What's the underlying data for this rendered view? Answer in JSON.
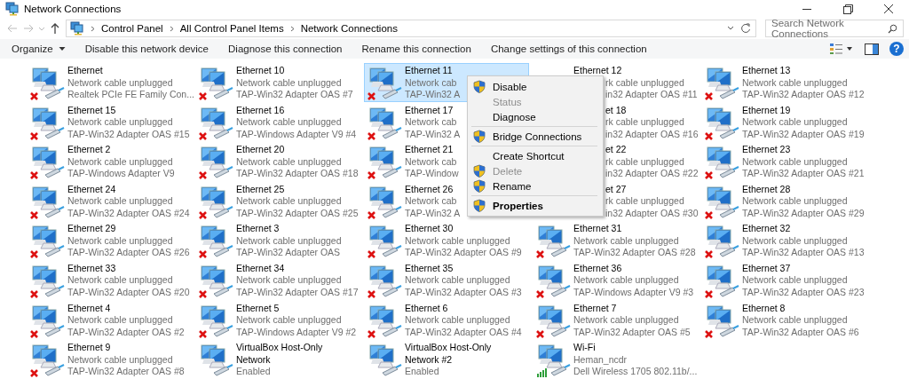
{
  "window": {
    "title": "Network Connections"
  },
  "address": {
    "crumbs": [
      "Control Panel",
      "All Control Panel Items",
      "Network Connections"
    ],
    "search_placeholder": "Search Network Connections"
  },
  "toolbar": {
    "buttons": [
      {
        "label": "Organize",
        "dropdown": true
      },
      {
        "label": "Disable this network device",
        "dropdown": false
      },
      {
        "label": "Diagnose this connection",
        "dropdown": false
      },
      {
        "label": "Rename this connection",
        "dropdown": false
      },
      {
        "label": "Change settings of this connection",
        "dropdown": false
      }
    ],
    "help": "?"
  },
  "items": [
    {
      "name": "Ethernet",
      "status": "Network cable unplugged",
      "device": "Realtek PCIe FE Family Con...",
      "kind": "unplugged",
      "selected": false
    },
    {
      "name": "Ethernet 10",
      "status": "Network cable unplugged",
      "device": "TAP-Win32 Adapter OAS #7",
      "kind": "unplugged",
      "selected": false
    },
    {
      "name": "Ethernet 11",
      "status": "Network cab",
      "device": "TAP-Win32 A",
      "kind": "unplugged",
      "selected": true
    },
    {
      "name": "Ethernet 12",
      "status": "rk cable unplugged",
      "device": "in32 Adapter OAS #11",
      "selected": false,
      "lines_clipped": true,
      "name_clipped": false
    },
    {
      "name": "Ethernet 13",
      "status": "Network cable unplugged",
      "device": "TAP-Win32 Adapter OAS #12",
      "kind": "unplugged",
      "selected": false
    },
    {
      "name": "Ethernet 15",
      "status": "Network cable unplugged",
      "device": "TAP-Win32 Adapter OAS #15",
      "kind": "unplugged",
      "selected": false
    },
    {
      "name": "Ethernet 16",
      "status": "Network cable unplugged",
      "device": "TAP-Windows Adapter V9 #4",
      "kind": "unplugged",
      "selected": false
    },
    {
      "name": "Ethernet 17",
      "status": "Network cab",
      "device": "TAP-Win32 A",
      "kind": "unplugged",
      "selected": false
    },
    {
      "name": "et 18",
      "status": "rk cable unplugged",
      "device": "in32 Adapter OAS #16",
      "selected": false,
      "lines_clipped": true,
      "name_clipped": true
    },
    {
      "name": "Ethernet 19",
      "status": "Network cable unplugged",
      "device": "TAP-Win32 Adapter OAS #19",
      "kind": "unplugged",
      "selected": false
    },
    {
      "name": "Ethernet 2",
      "status": "Network cable unplugged",
      "device": "TAP-Windows Adapter V9",
      "kind": "unplugged",
      "selected": false
    },
    {
      "name": "Ethernet 20",
      "status": "Network cable unplugged",
      "device": "TAP-Win32 Adapter OAS #18",
      "kind": "unplugged",
      "selected": false
    },
    {
      "name": "Ethernet 21",
      "status": "Network cab",
      "device": "TAP-Window",
      "kind": "unplugged",
      "selected": false
    },
    {
      "name": "et 22",
      "status": "rk cable unplugged",
      "device": "in32 Adapter OAS #22",
      "selected": false,
      "lines_clipped": true,
      "name_clipped": true
    },
    {
      "name": "Ethernet 23",
      "status": "Network cable unplugged",
      "device": "TAP-Win32 Adapter OAS #21",
      "kind": "unplugged",
      "selected": false
    },
    {
      "name": "Ethernet 24",
      "status": "Network cable unplugged",
      "device": "TAP-Win32 Adapter OAS #24",
      "kind": "unplugged",
      "selected": false
    },
    {
      "name": "Ethernet 25",
      "status": "Network cable unplugged",
      "device": "TAP-Win32 Adapter OAS #25",
      "kind": "unplugged",
      "selected": false
    },
    {
      "name": "Ethernet 26",
      "status": "Network cab",
      "device": "TAP-Win32 A",
      "kind": "unplugged",
      "selected": false
    },
    {
      "name": "et 27",
      "status": "rk cable unplugged",
      "device": "in32 Adapter OAS #30",
      "selected": false,
      "lines_clipped": true,
      "name_clipped": true
    },
    {
      "name": "Ethernet 28",
      "status": "Network cable unplugged",
      "device": "TAP-Win32 Adapter OAS #29",
      "kind": "unplugged",
      "selected": false
    },
    {
      "name": "Ethernet 29",
      "status": "Network cable unplugged",
      "device": "TAP-Win32 Adapter OAS #26",
      "kind": "unplugged",
      "selected": false
    },
    {
      "name": "Ethernet 3",
      "status": "Network cable unplugged",
      "device": "TAP-Win32 Adapter OAS",
      "kind": "unplugged",
      "selected": false
    },
    {
      "name": "Ethernet 30",
      "status": "Network cable unplugged",
      "device": "TAP-Win32 Adapter OAS #9",
      "kind": "unplugged",
      "selected": false
    },
    {
      "name": "Ethernet 31",
      "status": "Network cable unplugged",
      "device": "TAP-Win32 Adapter OAS #28",
      "kind": "unplugged",
      "selected": false
    },
    {
      "name": "Ethernet 32",
      "status": "Network cable unplugged",
      "device": "TAP-Win32 Adapter OAS #13",
      "kind": "unplugged",
      "selected": false
    },
    {
      "name": "Ethernet 33",
      "status": "Network cable unplugged",
      "device": "TAP-Win32 Adapter OAS #20",
      "kind": "unplugged",
      "selected": false
    },
    {
      "name": "Ethernet 34",
      "status": "Network cable unplugged",
      "device": "TAP-Win32 Adapter OAS #17",
      "kind": "unplugged",
      "selected": false
    },
    {
      "name": "Ethernet 35",
      "status": "Network cable unplugged",
      "device": "TAP-Win32 Adapter OAS #3",
      "kind": "unplugged",
      "selected": false
    },
    {
      "name": "Ethernet 36",
      "status": "Network cable unplugged",
      "device": "TAP-Windows Adapter V9 #3",
      "kind": "unplugged",
      "selected": false
    },
    {
      "name": "Ethernet 37",
      "status": "Network cable unplugged",
      "device": "TAP-Win32 Adapter OAS #23",
      "kind": "unplugged",
      "selected": false
    },
    {
      "name": "Ethernet 4",
      "status": "Network cable unplugged",
      "device": "TAP-Win32 Adapter OAS #2",
      "kind": "unplugged",
      "selected": false
    },
    {
      "name": "Ethernet 5",
      "status": "Network cable unplugged",
      "device": "TAP-Windows Adapter V9 #2",
      "kind": "unplugged",
      "selected": false
    },
    {
      "name": "Ethernet 6",
      "status": "Network cable unplugged",
      "device": "TAP-Win32 Adapter OAS #4",
      "kind": "unplugged",
      "selected": false
    },
    {
      "name": "Ethernet 7",
      "status": "Network cable unplugged",
      "device": "TAP-Win32 Adapter OAS #5",
      "kind": "unplugged",
      "selected": false
    },
    {
      "name": "Ethernet 8",
      "status": "Network cable unplugged",
      "device": "TAP-Win32 Adapter OAS #6",
      "kind": "unplugged",
      "selected": false
    },
    {
      "name": "Ethernet 9",
      "status": "Network cable unplugged",
      "device": "TAP-Win32 Adapter OAS #8",
      "kind": "unplugged",
      "selected": false
    },
    {
      "name": "VirtualBox Host-Only Network",
      "status": "Enabled",
      "kind": "wired",
      "selected": false
    },
    {
      "name": "VirtualBox Host-Only Network #2",
      "status": "Enabled",
      "kind": "wired",
      "selected": false
    },
    {
      "name": "Wi-Fi",
      "status": "Heman_ncdr",
      "device": "Dell Wireless 1705 802.11b/...",
      "kind": "wifi",
      "selected": false
    }
  ],
  "context_menu": {
    "items": [
      {
        "kind": "shield",
        "label": "Disable",
        "disabled": false,
        "default": false
      },
      {
        "kind": "plain",
        "label": "Status",
        "disabled": true,
        "default": false
      },
      {
        "kind": "plain",
        "label": "Diagnose",
        "disabled": false,
        "default": false
      },
      {
        "kind": "separator"
      },
      {
        "kind": "shield",
        "label": "Bridge Connections",
        "disabled": false,
        "default": false
      },
      {
        "kind": "separator"
      },
      {
        "kind": "plain",
        "label": "Create Shortcut",
        "disabled": false,
        "default": false
      },
      {
        "kind": "shield",
        "label": "Delete",
        "disabled": true,
        "default": false
      },
      {
        "kind": "shield",
        "label": "Rename",
        "disabled": false,
        "default": false
      },
      {
        "kind": "separator"
      },
      {
        "kind": "shield",
        "label": "Properties",
        "disabled": false,
        "default": true
      }
    ]
  }
}
